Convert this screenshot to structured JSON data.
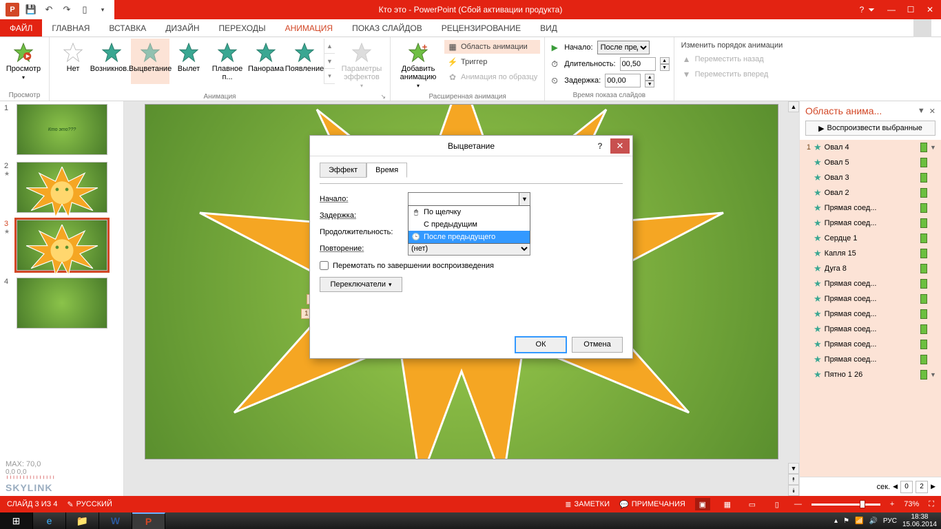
{
  "title": "Кто это -  PowerPoint (Сбой активации продукта)",
  "tabs": {
    "file": "ФАЙЛ",
    "home": "ГЛАВНАЯ",
    "insert": "ВСТАВКА",
    "design": "ДИЗАЙН",
    "transitions": "ПЕРЕХОДЫ",
    "animation": "АНИМАЦИЯ",
    "slideshow": "ПОКАЗ СЛАЙДОВ",
    "review": "РЕЦЕНЗИРОВАНИЕ",
    "view": "ВИД"
  },
  "ribbon": {
    "preview_btn": "Просмотр",
    "preview_group": "Просмотр",
    "anim": {
      "none": "Нет",
      "appear": "Возникнов...",
      "fade": "Выцветание",
      "fly": "Вылет",
      "float": "Плавное п...",
      "panorama": "Панорама",
      "shape": "Появление",
      "group": "Анимация"
    },
    "effect_opts": "Параметры эффектов",
    "adv": {
      "add": "Добавить анимацию",
      "pane": "Область анимации",
      "trigger": "Триггер",
      "painter": "Анимация по образцу",
      "group": "Расширенная анимация"
    },
    "timing": {
      "start": "Начало:",
      "start_val": "После пред...",
      "duration": "Длительность:",
      "duration_val": "00,50",
      "delay": "Задержка:",
      "delay_val": "00,00",
      "group": "Время показа слайдов"
    },
    "reorder": {
      "title": "Изменить порядок анимации",
      "back": "Переместить назад",
      "fwd": "Переместить вперед"
    }
  },
  "thumbs": {
    "s1_text": "Кто это???",
    "watermark_max": "MAX: 70,0",
    "watermark_dl": "0,0      0,0",
    "watermark_brand": "SKYLINK"
  },
  "canvas": {
    "tag1": "1",
    "tag2": "1"
  },
  "anim_pane": {
    "title": "Область анима...",
    "play": "Воспроизвести выбранные",
    "items": [
      {
        "idx": "1",
        "name": "Овал 4",
        "menu": true
      },
      {
        "idx": "",
        "name": "Овал 5"
      },
      {
        "idx": "",
        "name": "Овал 3"
      },
      {
        "idx": "",
        "name": "Овал 2"
      },
      {
        "idx": "",
        "name": "Прямая соед..."
      },
      {
        "idx": "",
        "name": "Прямая соед..."
      },
      {
        "idx": "",
        "name": "Сердце 1"
      },
      {
        "idx": "",
        "name": "Капля 15"
      },
      {
        "idx": "",
        "name": "Дуга 8"
      },
      {
        "idx": "",
        "name": "Прямая соед..."
      },
      {
        "idx": "",
        "name": "Прямая соед..."
      },
      {
        "idx": "",
        "name": "Прямая соед..."
      },
      {
        "idx": "",
        "name": "Прямая соед..."
      },
      {
        "idx": "",
        "name": "Прямая соед..."
      },
      {
        "idx": "",
        "name": "Прямая соед..."
      },
      {
        "idx": "",
        "name": "Пятно 1 26",
        "menu": true
      }
    ],
    "sec": "сек.",
    "ord0": "0",
    "ord2": "2"
  },
  "dialog": {
    "title": "Выцветание",
    "tab_effect": "Эффект",
    "tab_time": "Время",
    "start": "Начало:",
    "delay": "Задержка:",
    "duration": "Продолжительность:",
    "repeat": "Повторение:",
    "repeat_val": "(нет)",
    "rewind": "Перемотать по завершении воспроизведения",
    "toggles": "Переключатели",
    "opts": {
      "click": "По щелчку",
      "with": "С предыдущим",
      "after": "После предыдущего"
    },
    "ok": "ОК",
    "cancel": "Отмена"
  },
  "status": {
    "slide": "СЛАЙД 3 ИЗ 4",
    "lang": "РУССКИЙ",
    "notes": "ЗАМЕТКИ",
    "comments": "ПРИМЕЧАНИЯ",
    "zoom": "73%"
  },
  "tray": {
    "lang": "РУС",
    "time": "18:38",
    "date": "15.06.2014"
  }
}
